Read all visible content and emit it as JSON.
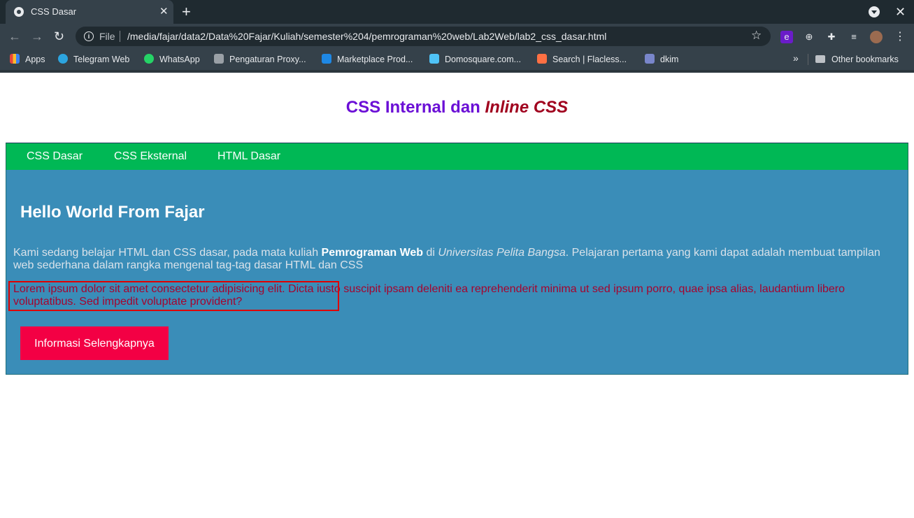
{
  "browser": {
    "tab_title": "CSS Dasar",
    "scheme_label": "File",
    "url": "/media/fajar/data2/Data%20Fajar/Kuliah/semester%204/pemrograman%20web/Lab2Web/lab2_css_dasar.html",
    "bookmarks": [
      {
        "label": "Apps",
        "icon": "apps-grid-icon",
        "color": "#e8453c"
      },
      {
        "label": "Telegram Web",
        "icon": "telegram-icon",
        "color": "#2ca5e0"
      },
      {
        "label": "WhatsApp",
        "icon": "whatsapp-icon",
        "color": "#25d366"
      },
      {
        "label": "Pengaturan Proxy...",
        "icon": "proxy-icon",
        "color": "#9aa0a6"
      },
      {
        "label": "Marketplace Prod...",
        "icon": "marketplace-icon",
        "color": "#1e88e5"
      },
      {
        "label": "Domosquare.com...",
        "icon": "cube-icon",
        "color": "#4fc3f7"
      },
      {
        "label": "Search | Flacless...",
        "icon": "search-flacless-icon",
        "color": "#ff7043"
      },
      {
        "label": "dkim",
        "icon": "puzzle-icon",
        "color": "#7986cb"
      }
    ],
    "other_bookmarks": "Other bookmarks"
  },
  "page": {
    "heading_plain": "CSS Internal dan ",
    "heading_italic": "Inline CSS",
    "nav": [
      "CSS Dasar",
      "CSS Eksternal",
      "HTML Dasar"
    ],
    "main_title": "Hello World From Fajar",
    "intro": {
      "part1": "Kami sedang belajar HTML dan CSS dasar, pada mata kuliah ",
      "bold": "Pemrograman Web",
      "part2": " di ",
      "italic": "Universitas Pelita Bangsa",
      "part3": ". Pelajaran pertama yang kami dapat adalah membuat tampilan web sederhana dalam rangka mengenal tag-tag dasar HTML dan CSS"
    },
    "lorem": "Lorem ipsum dolor sit amet consectetur adipisicing elit. Dicta iusto suscipit ipsam deleniti ea reprehenderit minima ut sed ipsum porro, quae ipsa alias, laudantium libero voluptatibus. Sed impedit voluptate provident?",
    "button_label": "Informasi Selengkapnya"
  },
  "colors": {
    "heading": "#6b0fd6",
    "heading_italic": "#a0001e",
    "nav_bg": "#00b855",
    "main_bg": "#3a8db8",
    "lorem": "#a5042e",
    "button_bg": "#f30044",
    "highlight_border": "#e00000"
  }
}
